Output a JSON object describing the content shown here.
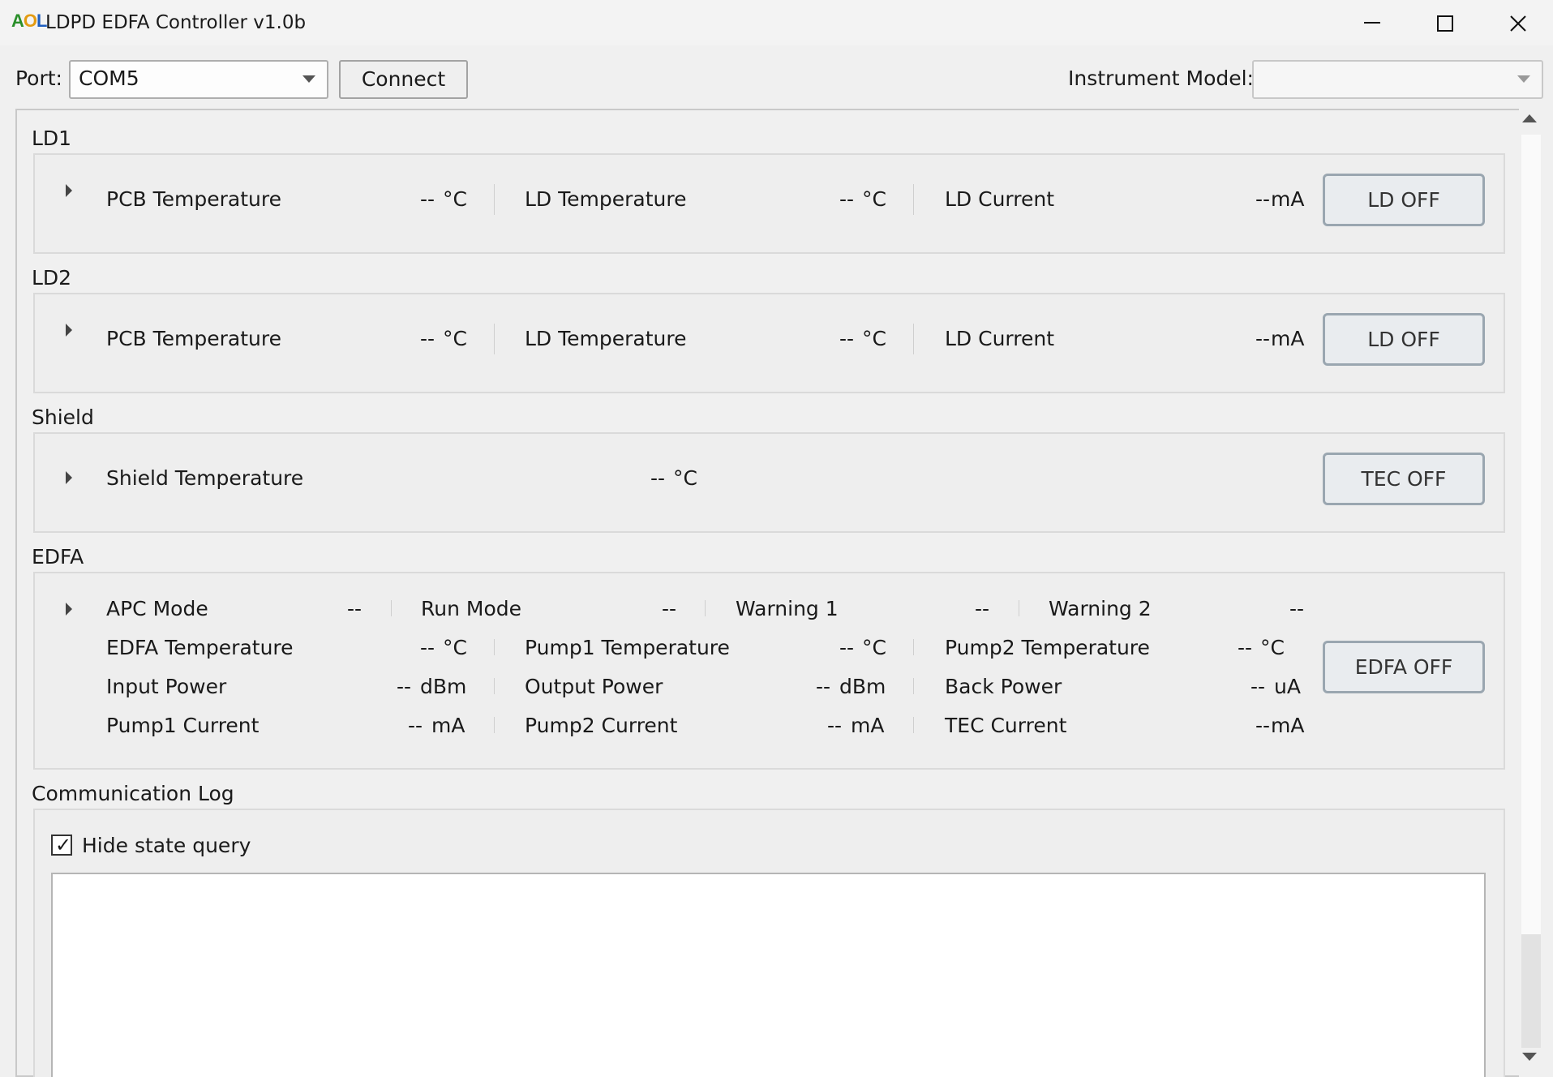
{
  "window": {
    "logo": "AOL",
    "title": "LDPD EDFA Controller v1.0b",
    "controls": {
      "minimize": "minimize-icon",
      "maximize": "maximize-icon",
      "close": "close-icon"
    }
  },
  "toolbar": {
    "port_label": "Port:",
    "port_value": "COM5",
    "connect_label": "Connect",
    "model_label": "Instrument Model:",
    "model_value": ""
  },
  "ld1": {
    "title": "LD1",
    "pcb_label": "PCB Temperature",
    "pcb_value": "--",
    "pcb_unit": "°C",
    "ldt_label": "LD Temperature",
    "ldt_value": "--",
    "ldt_unit": "°C",
    "ldc_label": "LD Current",
    "ldc_value": "--",
    "ldc_unit": "mA",
    "button": "LD OFF"
  },
  "ld2": {
    "title": "LD2",
    "pcb_label": "PCB Temperature",
    "pcb_value": "--",
    "pcb_unit": "°C",
    "ldt_label": "LD Temperature",
    "ldt_value": "--",
    "ldt_unit": "°C",
    "ldc_label": "LD Current",
    "ldc_value": "--",
    "ldc_unit": "mA",
    "button": "LD OFF"
  },
  "shield": {
    "title": "Shield",
    "temp_label": "Shield Temperature",
    "temp_value": "--",
    "temp_unit": "°C",
    "button": "TEC OFF"
  },
  "edfa": {
    "title": "EDFA",
    "apc_label": "APC Mode",
    "apc_value": "--",
    "run_label": "Run Mode",
    "run_value": "--",
    "w1_label": "Warning 1",
    "w1_value": "--",
    "w2_label": "Warning 2",
    "w2_value": "--",
    "et_label": "EDFA Temperature",
    "et_value": "--",
    "et_unit": "°C",
    "p1t_label": "Pump1 Temperature",
    "p1t_value": "--",
    "p1t_unit": "°C",
    "p2t_label": "Pump2 Temperature",
    "p2t_value": "--",
    "p2t_unit": "°C",
    "ip_label": "Input Power",
    "ip_value": "--",
    "ip_unit": "dBm",
    "op_label": "Output Power",
    "op_value": "--",
    "op_unit": "dBm",
    "bp_label": "Back Power",
    "bp_value": "--",
    "bp_unit": "uA",
    "p1c_label": "Pump1 Current",
    "p1c_value": "--",
    "p1c_unit": "mA",
    "p2c_label": "Pump2 Current",
    "p2c_value": "--",
    "p2c_unit": "mA",
    "tec_label": "TEC Current",
    "tec_value": "--",
    "tec_unit": "mA",
    "button": "EDFA OFF"
  },
  "log": {
    "title": "Communication Log",
    "hide_label": "Hide state query",
    "hide_checked": true,
    "content": ""
  }
}
